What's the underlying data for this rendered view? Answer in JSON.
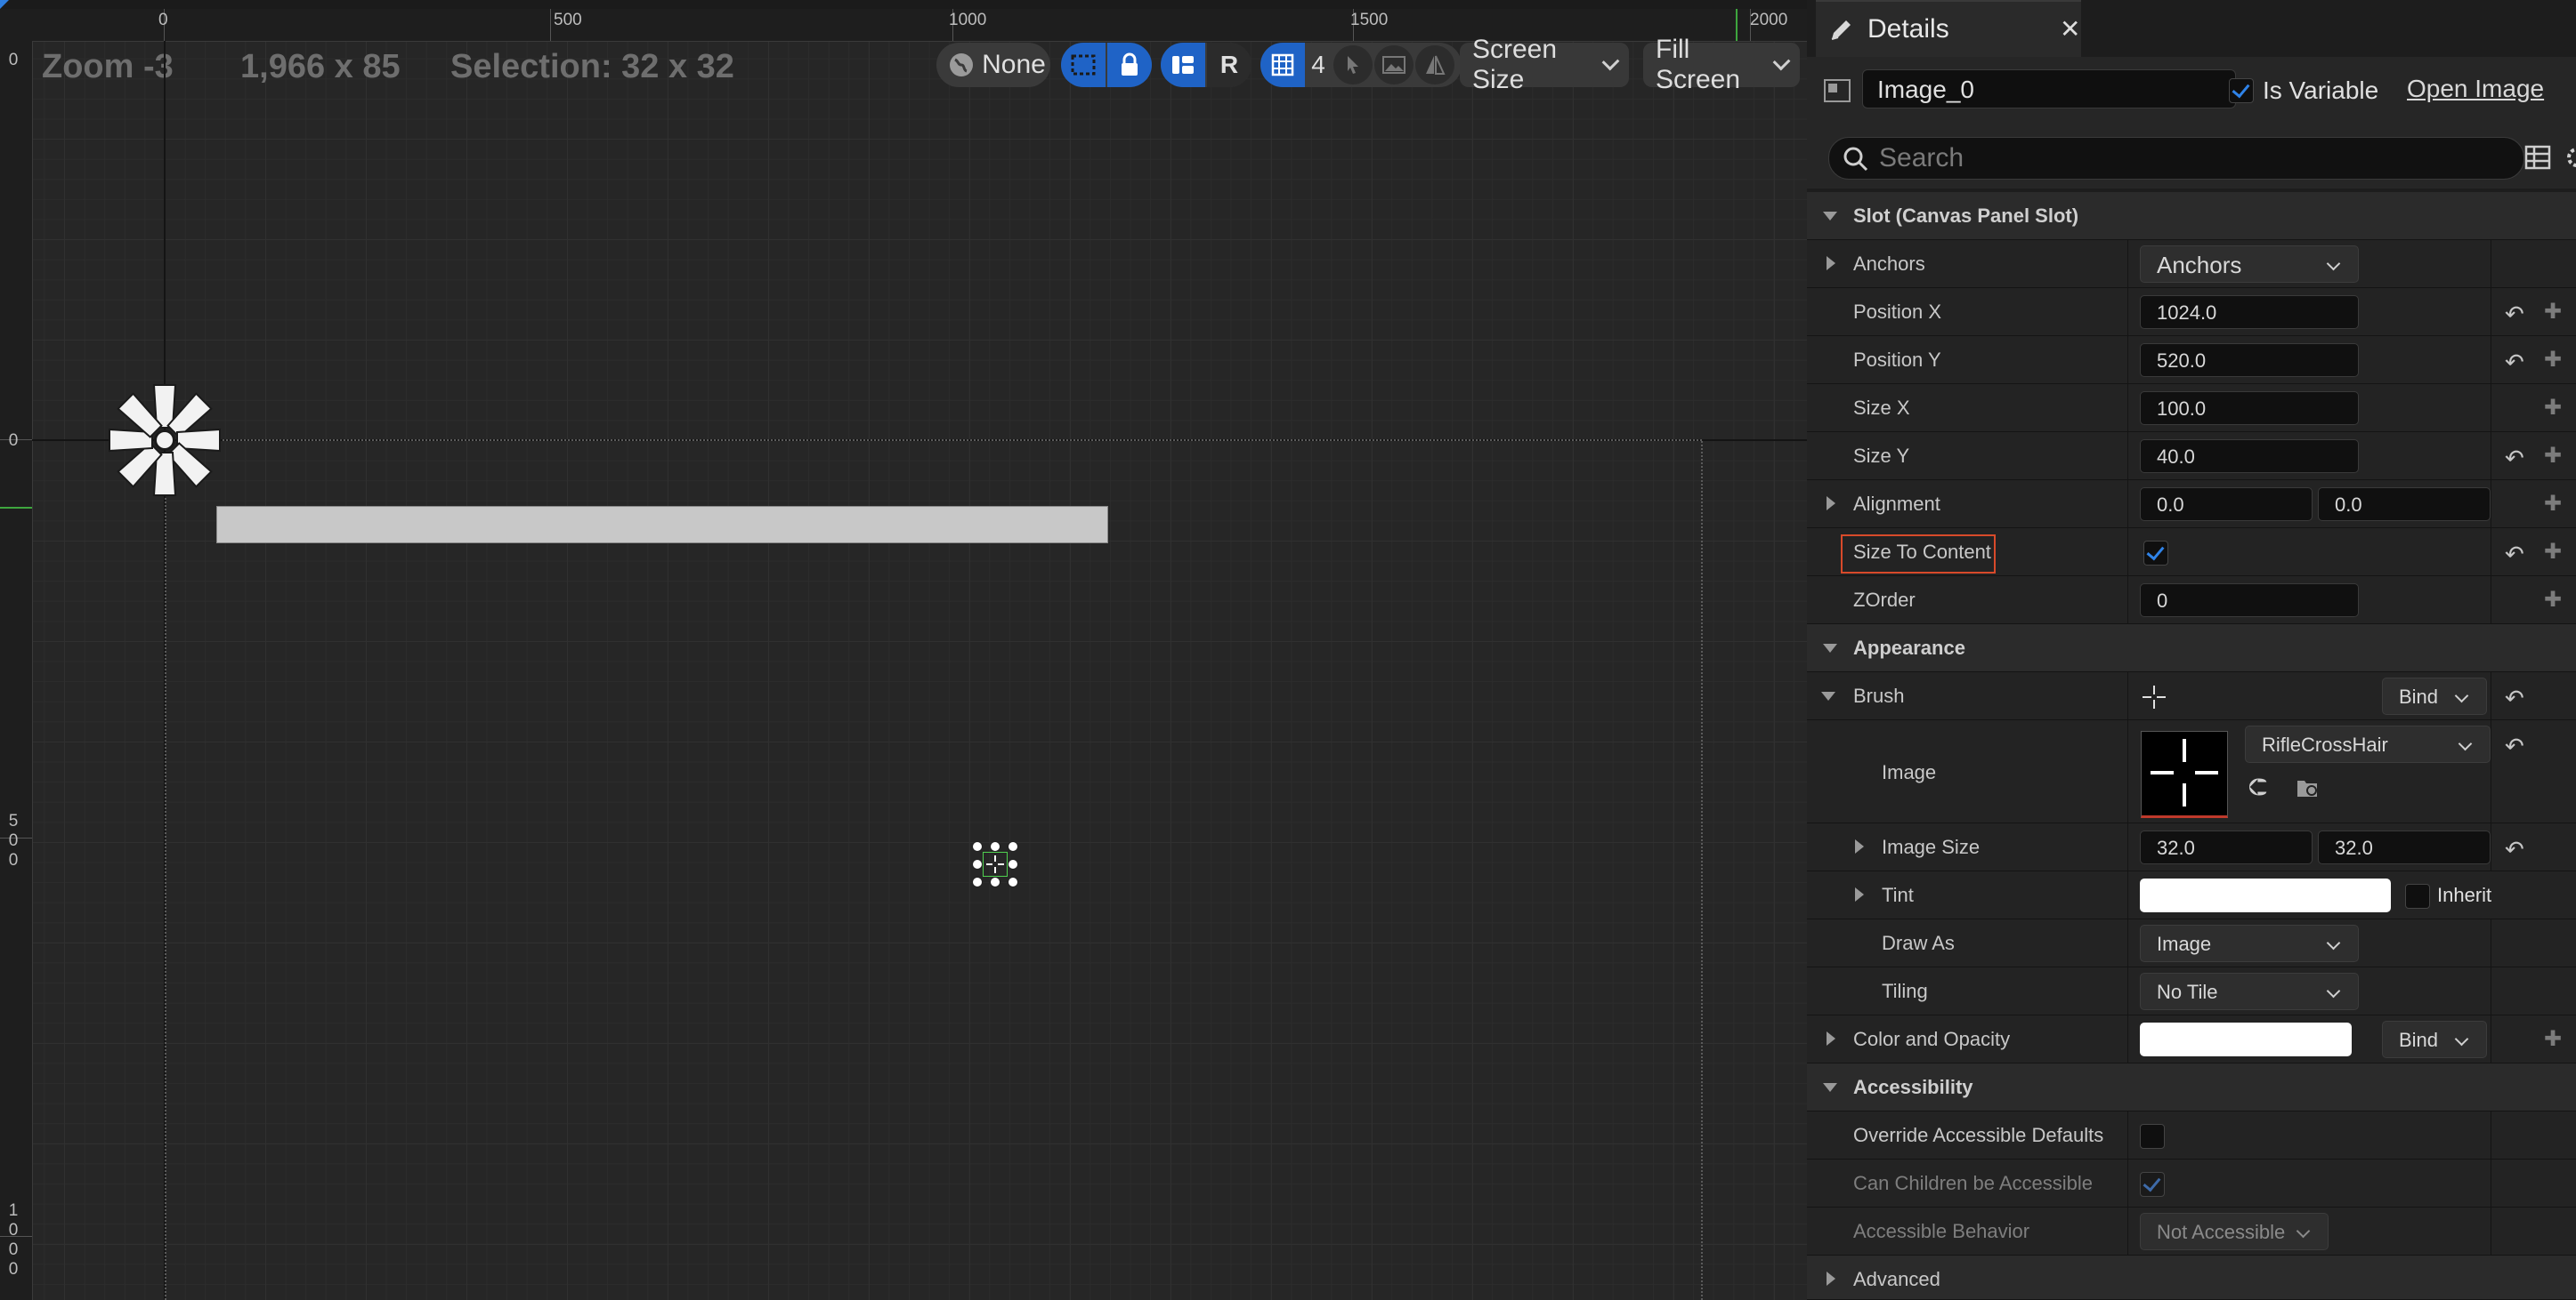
{
  "canvas": {
    "zoom": "Zoom -3",
    "resolution": "1,966 x 85",
    "selection": "Selection: 32 x 32",
    "ruler_top": [
      "0",
      "500",
      "1000",
      "1500",
      "2000"
    ],
    "ruler_left": [
      [
        "0"
      ],
      [
        "0"
      ],
      [
        "5",
        "0",
        "0"
      ],
      [
        "1",
        "0",
        "0",
        "0"
      ]
    ],
    "toolbar": {
      "none_label": "None",
      "r_label": "R",
      "grid_number": "4",
      "screen_size": "Screen Size",
      "fill_screen": "Fill Screen"
    },
    "progress_fill_percent": 100
  },
  "details": {
    "tab_title": "Details",
    "close_glyph": "✕",
    "widget_name": "Image_0",
    "is_variable_label": "Is Variable",
    "open_image": "Open Image",
    "search_placeholder": "Search",
    "slot_section": "Slot (Canvas Panel Slot)",
    "anchors_label": "Anchors",
    "anchors_value": "Anchors",
    "position_x_label": "Position X",
    "position_x": "1024.0",
    "position_y_label": "Position Y",
    "position_y": "520.0",
    "size_x_label": "Size X",
    "size_x": "100.0",
    "size_y_label": "Size Y",
    "size_y": "40.0",
    "alignment_label": "Alignment",
    "alignment_x": "0.0",
    "alignment_y": "0.0",
    "size_to_content_label": "Size To Content",
    "zorder_label": "ZOrder",
    "zorder": "0",
    "appearance_section": "Appearance",
    "brush_label": "Brush",
    "bind_label": "Bind",
    "image_label": "Image",
    "image_asset": "RifleCrossHair",
    "image_size_label": "Image Size",
    "image_size_x": "32.0",
    "image_size_y": "32.0",
    "tint_label": "Tint",
    "inherit_label": "Inherit",
    "draw_as_label": "Draw As",
    "draw_as_value": "Image",
    "tiling_label": "Tiling",
    "tiling_value": "No Tile",
    "color_opacity_label": "Color and Opacity",
    "accessibility_section": "Accessibility",
    "override_label": "Override Accessible Defaults",
    "can_children_label": "Can Children be Accessible",
    "behavior_label": "Accessible Behavior",
    "behavior_value": "Not Accessible",
    "advanced_section": "Advanced"
  }
}
